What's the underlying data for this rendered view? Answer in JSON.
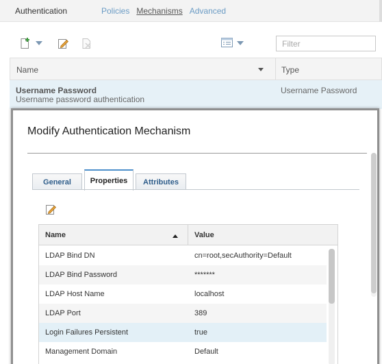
{
  "header": {
    "title": "Authentication",
    "nav": [
      "Policies",
      "Mechanisms",
      "Advanced"
    ],
    "active_nav": "Mechanisms"
  },
  "toolbar": {
    "icons": [
      "new-icon",
      "dropdown-caret-icon",
      "edit-icon",
      "delete-icon",
      "view-options-icon"
    ],
    "filter_placeholder": "Filter"
  },
  "mechanisms_table": {
    "columns": [
      "Name",
      "Type"
    ],
    "rows": [
      {
        "name": "Username Password",
        "description": "Username password authentication",
        "type": "Username Password"
      }
    ]
  },
  "dialog": {
    "title": "Modify Authentication Mechanism",
    "tabs": [
      "General",
      "Properties",
      "Attributes"
    ],
    "active_tab": "Properties",
    "properties_table": {
      "columns": [
        "Name",
        "Value"
      ],
      "rows": [
        {
          "name": "LDAP Bind DN",
          "value": "cn=root,secAuthority=Default"
        },
        {
          "name": "LDAP Bind Password",
          "value": "*******"
        },
        {
          "name": "LDAP Host Name",
          "value": "localhost"
        },
        {
          "name": "LDAP Port",
          "value": "389"
        },
        {
          "name": "Login Failures Persistent",
          "value": "true"
        },
        {
          "name": "Management Domain",
          "value": "Default"
        }
      ],
      "selected_row": "Login Failures Persistent"
    }
  }
}
